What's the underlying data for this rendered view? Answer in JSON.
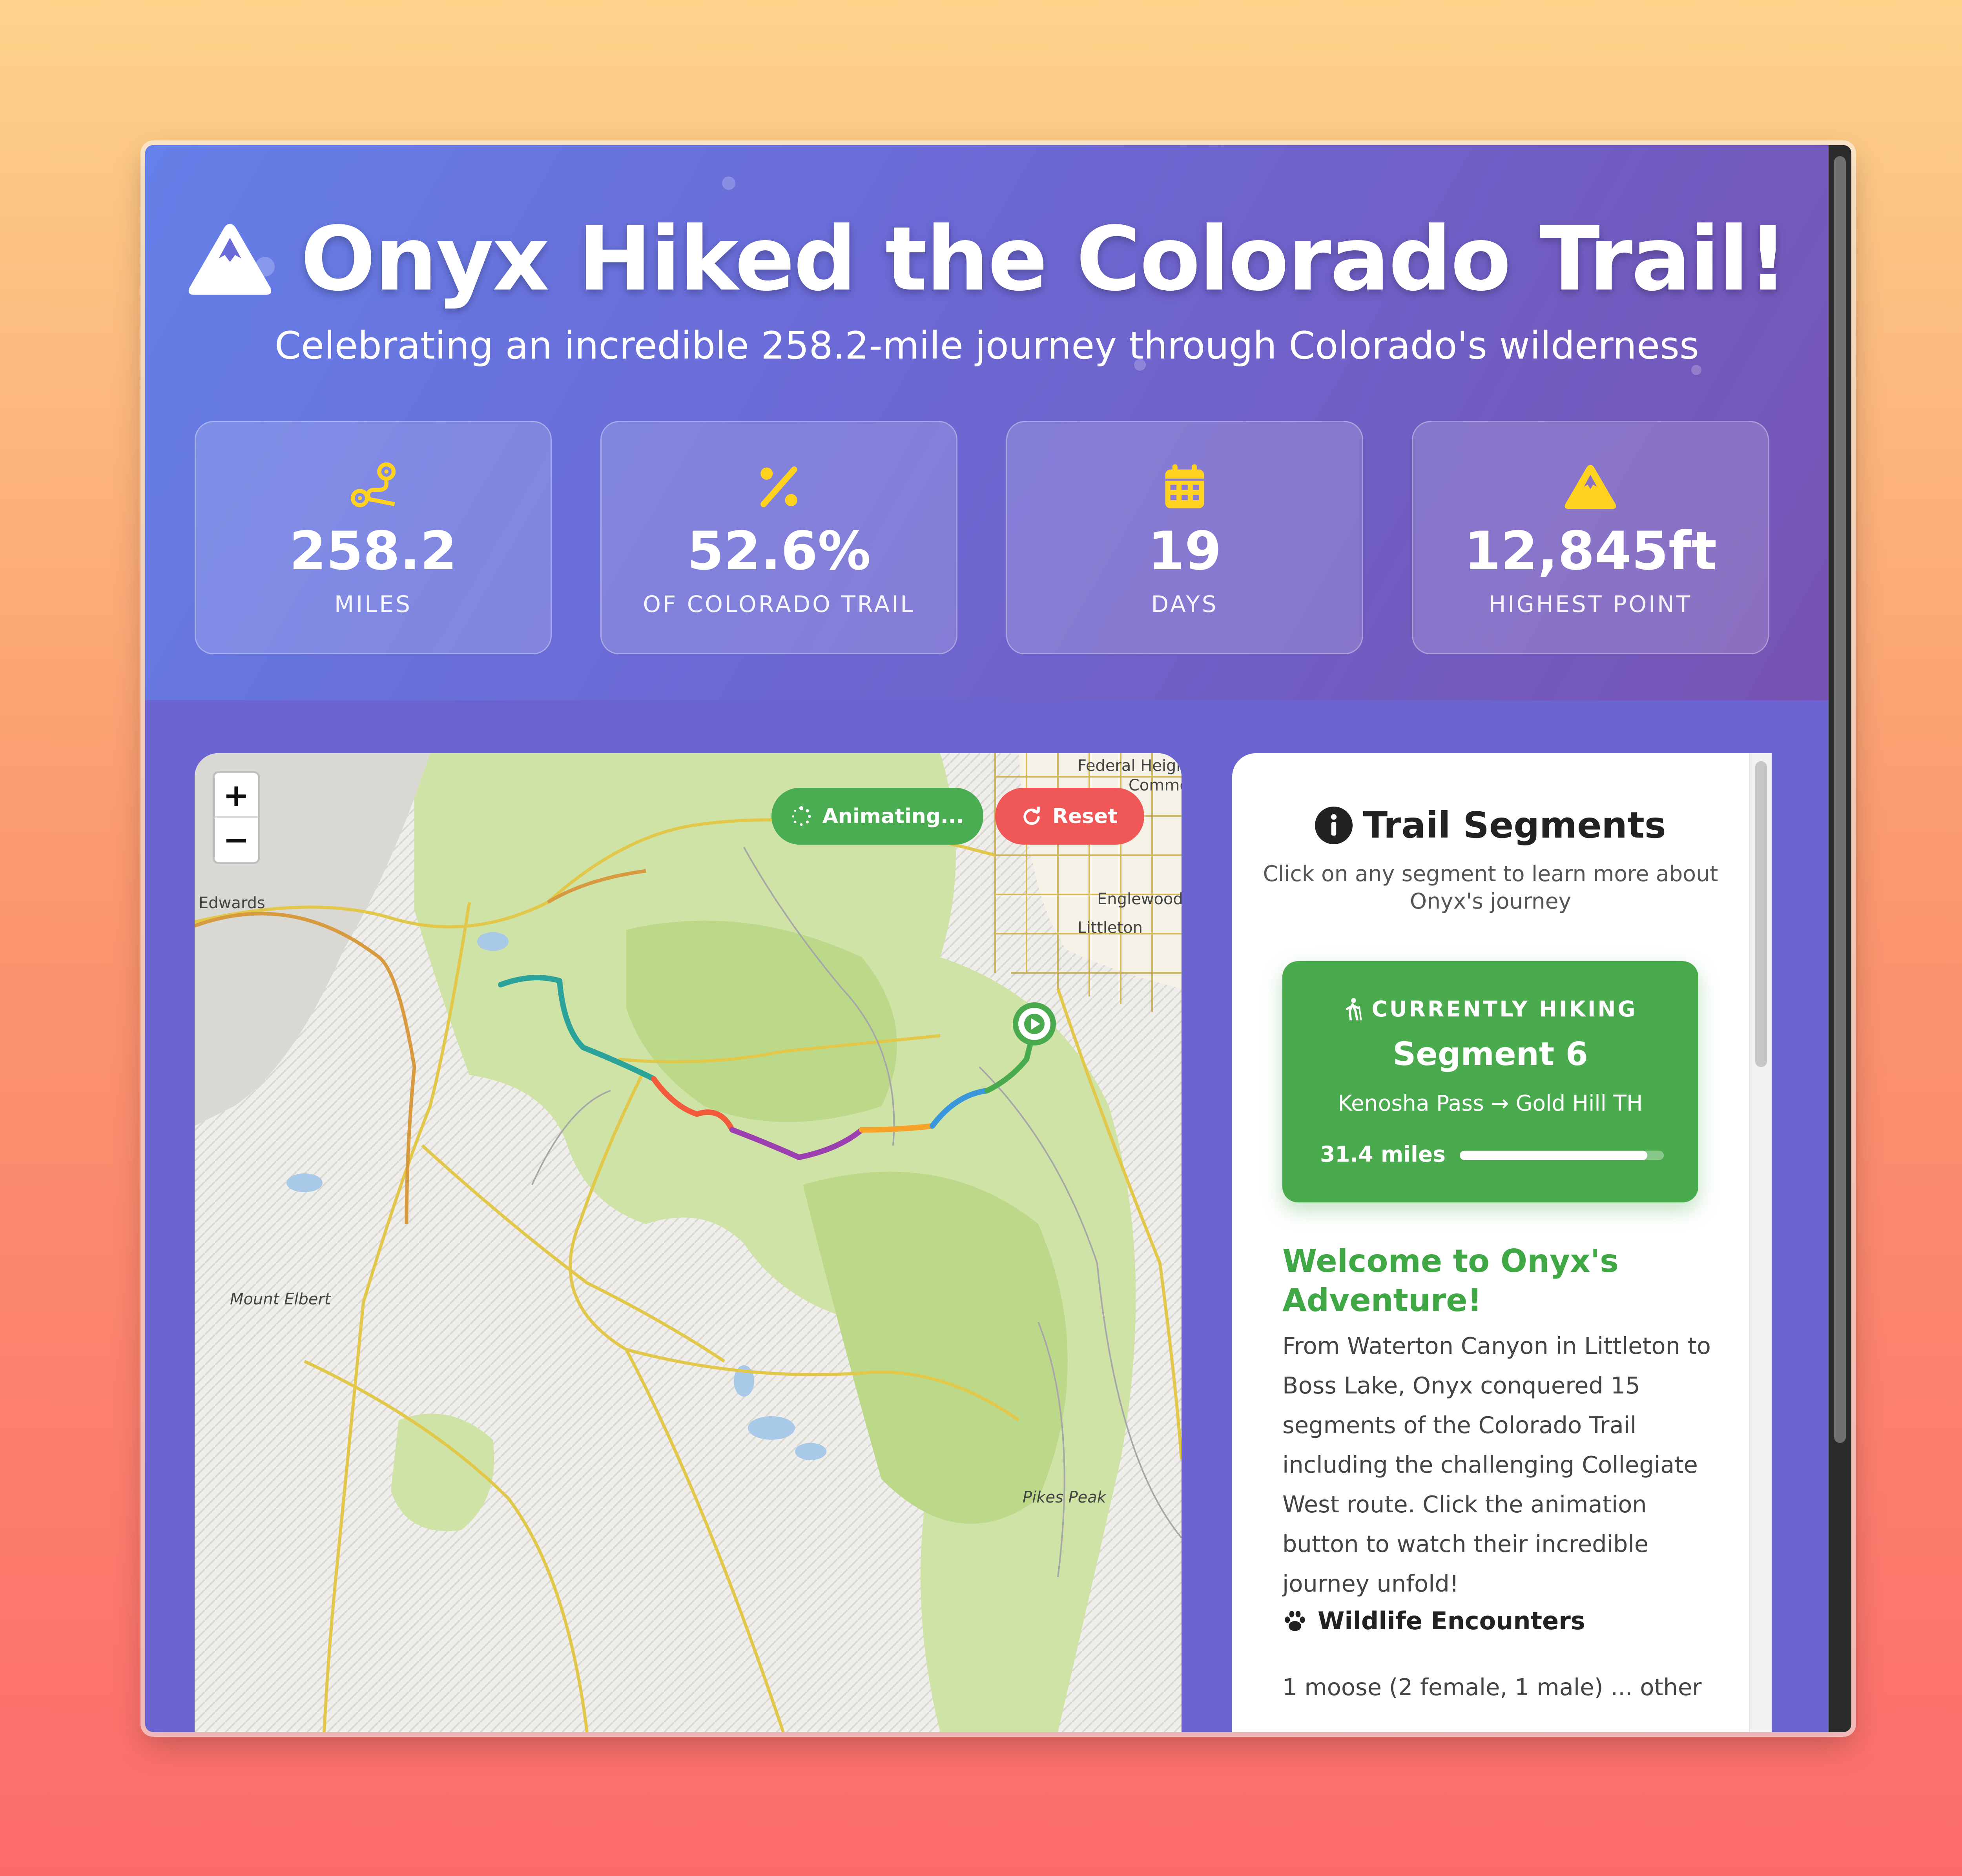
{
  "header": {
    "title": "Onyx Hiked the Colorado Trail!",
    "subtitle": "Celebrating an incredible 258.2-mile journey through Colorado's wilderness"
  },
  "stats": [
    {
      "icon": "route-icon",
      "value": "258.2",
      "label": "MILES"
    },
    {
      "icon": "percent-icon",
      "value": "52.6%",
      "label": "OF COLORADO TRAIL"
    },
    {
      "icon": "calendar-icon",
      "value": "19",
      "label": "DAYS"
    },
    {
      "icon": "mountain-icon",
      "value": "12,845ft",
      "label": "HIGHEST POINT"
    }
  ],
  "map": {
    "zoom_in": "+",
    "zoom_out": "−",
    "animate_label": "Animating...",
    "reset_label": "Reset",
    "place_labels": [
      "Edwards",
      "Mount Elbert",
      "Pikes Peak",
      "Federal Heights",
      "Englewood",
      "Littleton",
      "Commerce"
    ]
  },
  "panel": {
    "title": "Trail Segments",
    "subtitle": "Click on any segment to learn more about Onyx's journey",
    "current": {
      "label": "CURRENTLY HIKING",
      "segment": "Segment 6",
      "route": "Kenosha Pass → Gold Hill TH",
      "miles": "31.4 miles",
      "progress": 0.92
    },
    "welcome_title": "Welcome to Onyx's Adventure!",
    "welcome_text": "From Waterton Canyon in Littleton to Boss Lake, Onyx conquered 15 segments of the Colorado Trail including the challenging Collegiate West route. Click the animation button to watch their incredible journey unfold!",
    "wildlife_title": "Wildlife Encounters",
    "wildlife_text": "1 moose (2 female, 1 male) ... other"
  },
  "colors": {
    "accent_green": "#4aab4e",
    "reset_red": "#f05858",
    "stat_icon_yellow": "#ffd21f",
    "header_gradient_start": "#6580e8",
    "header_gradient_end": "#7653b3"
  }
}
